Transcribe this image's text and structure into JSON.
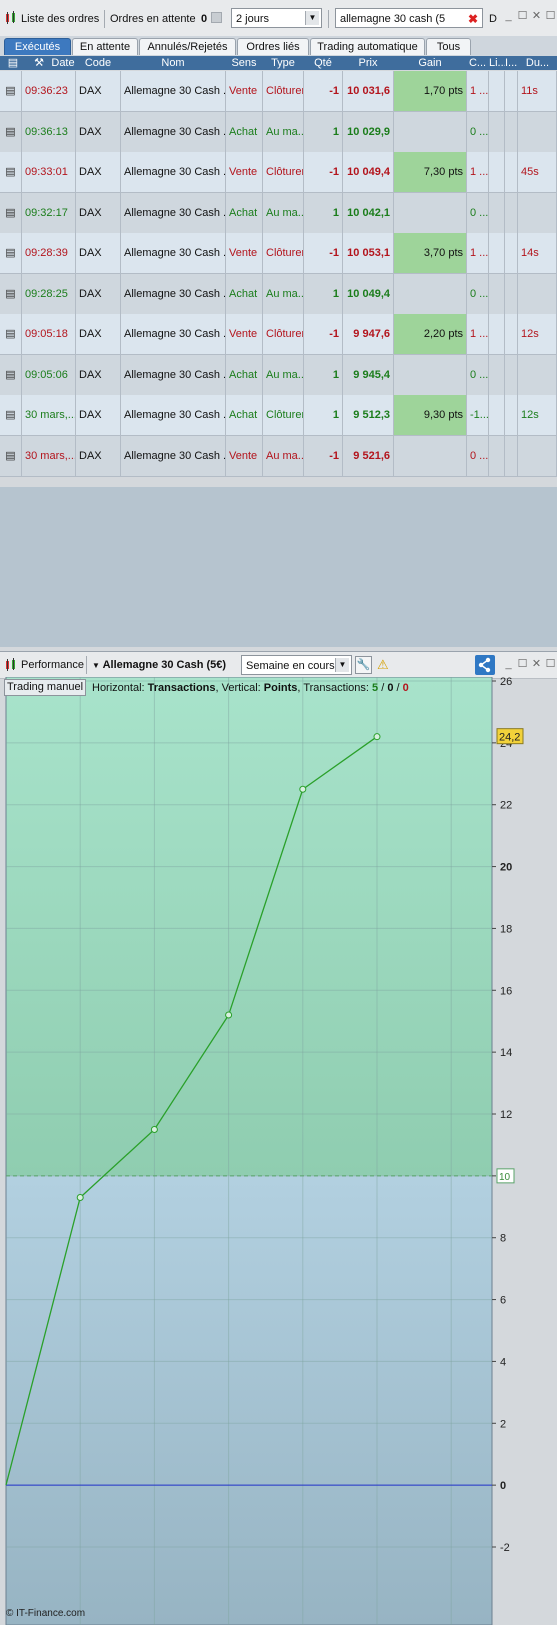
{
  "toolbar": {
    "orders_list_label": "Liste des ordres",
    "pending_label": "Ordres en attente",
    "pending_count": "0",
    "period_value": "2 jours",
    "search_value": "allemagne 30 cash (5",
    "trailing_label": "D"
  },
  "tabs": [
    "Exécutés",
    "En attente",
    "Annulés/Rejetés",
    "Ordres liés",
    "Trading automatique",
    "Tous"
  ],
  "table": {
    "headers": [
      "Date",
      "Code",
      "Nom",
      "Sens",
      "Type",
      "Qté",
      "Prix",
      "Gain",
      "C...",
      "Li...",
      "I...",
      "Du..."
    ],
    "rows": [
      {
        "date": "09:36:23",
        "code": "DAX",
        "nom": "Allemagne 30 Cash ...",
        "sens": "Vente",
        "type": "Clôturer",
        "qte": "-1",
        "prix": "10 031,6",
        "gain": "1,70 pts",
        "c": "1 ...",
        "du": "11s",
        "color": "red"
      },
      {
        "date": "09:36:13",
        "code": "DAX",
        "nom": "Allemagne 30 Cash ...",
        "sens": "Achat",
        "type": "Au ma...",
        "qte": "1",
        "prix": "10 029,9",
        "gain": "",
        "c": "0 ...",
        "du": "",
        "color": "green"
      },
      {
        "date": "09:33:01",
        "code": "DAX",
        "nom": "Allemagne 30 Cash ...",
        "sens": "Vente",
        "type": "Clôturer",
        "qte": "-1",
        "prix": "10 049,4",
        "gain": "7,30 pts",
        "c": "1 ...",
        "du": "45s",
        "color": "red"
      },
      {
        "date": "09:32:17",
        "code": "DAX",
        "nom": "Allemagne 30 Cash ...",
        "sens": "Achat",
        "type": "Au ma...",
        "qte": "1",
        "prix": "10 042,1",
        "gain": "",
        "c": "0 ...",
        "du": "",
        "color": "green"
      },
      {
        "date": "09:28:39",
        "code": "DAX",
        "nom": "Allemagne 30 Cash ...",
        "sens": "Vente",
        "type": "Clôturer",
        "qte": "-1",
        "prix": "10 053,1",
        "gain": "3,70 pts",
        "c": "1 ...",
        "du": "14s",
        "color": "red"
      },
      {
        "date": "09:28:25",
        "code": "DAX",
        "nom": "Allemagne 30 Cash ...",
        "sens": "Achat",
        "type": "Au ma...",
        "qte": "1",
        "prix": "10 049,4",
        "gain": "",
        "c": "0 ...",
        "du": "",
        "color": "green"
      },
      {
        "date": "09:05:18",
        "code": "DAX",
        "nom": "Allemagne 30 Cash ...",
        "sens": "Vente",
        "type": "Clôturer",
        "qte": "-1",
        "prix": "9 947,6",
        "gain": "2,20 pts",
        "c": "1 ...",
        "du": "12s",
        "color": "red"
      },
      {
        "date": "09:05:06",
        "code": "DAX",
        "nom": "Allemagne 30 Cash ...",
        "sens": "Achat",
        "type": "Au ma...",
        "qte": "1",
        "prix": "9 945,4",
        "gain": "",
        "c": "0 ...",
        "du": "",
        "color": "green"
      },
      {
        "date": "30 mars,...",
        "code": "DAX",
        "nom": "Allemagne 30 Cash ...",
        "sens": "Achat",
        "type": "Clôturer",
        "qte": "1",
        "prix": "9 512,3",
        "gain": "9,30 pts",
        "c": "-1...",
        "du": "12s",
        "color": "green"
      },
      {
        "date": "30 mars,...",
        "code": "DAX",
        "nom": "Allemagne 30 Cash ...",
        "sens": "Vente",
        "type": "Au ma...",
        "qte": "-1",
        "prix": "9 521,6",
        "gain": "",
        "c": "0 ...",
        "du": "",
        "color": "red"
      }
    ]
  },
  "performance": {
    "panel_label": "Performance",
    "instrument": "Allemagne 30 Cash (5€)",
    "period": "Semaine en cours",
    "mode_button": "Trading manuel",
    "info_horizontal_label": "Horizontal: ",
    "info_horizontal_value": "Transactions",
    "info_vertical_label": ", Vertical: ",
    "info_vertical_value": "Points",
    "info_transactions_label": ", Transactions: ",
    "info_count_total": "5",
    "info_count_neutral": "0",
    "info_count_loss": "0",
    "footer": "© IT-Finance.com"
  },
  "chart_data": {
    "type": "line",
    "x": [
      0,
      1,
      2,
      3,
      4,
      5
    ],
    "y": [
      0,
      9.3,
      11.5,
      15.2,
      22.5,
      24.2
    ],
    "last_value_label": "24,2",
    "reference_line_label": "10",
    "reference_value": 10,
    "ylim": [
      -2,
      26
    ],
    "y_ticks": [
      "26",
      "24",
      "22",
      "20",
      "18",
      "16",
      "14",
      "12",
      "10",
      "8",
      "6",
      "4",
      "2",
      "0",
      "-2"
    ],
    "grid": true,
    "colors": {
      "line": "#2aa02a",
      "upper_fill": "#a3dcc4",
      "lower_fill": "#a9c6d6",
      "zero_line": "#2233cc"
    }
  }
}
